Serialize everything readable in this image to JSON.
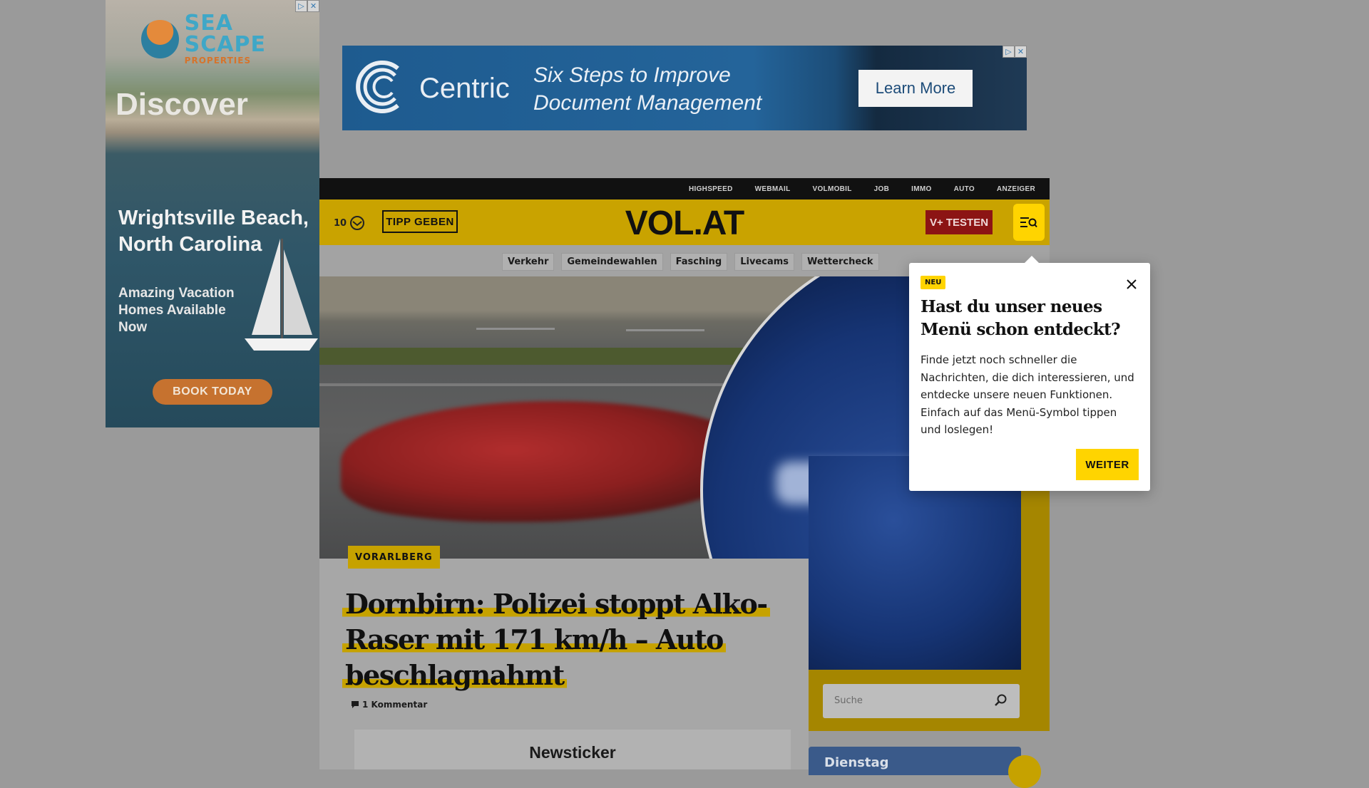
{
  "ads": {
    "skyscraper": {
      "brand": "SEA SCAPE",
      "brand_sub": "PROPERTIES",
      "discover": "Discover",
      "place": "Wrightsville Beach, North Carolina",
      "pitch": "Amazing Vacation Homes Available Now",
      "cta": "BOOK TODAY",
      "colors": {
        "cta": "#c6722f",
        "brand": "#3fa7c7"
      }
    },
    "banner": {
      "brand": "Centric",
      "headline_1": "Six Steps to Improve",
      "headline_2": "Document Management",
      "cta": "Learn More"
    },
    "adchoice_info": "▷",
    "adchoice_close": "✕"
  },
  "topbar": {
    "links": [
      "HIGHSPEED",
      "WEBMAIL",
      "VOLMOBIL",
      "JOB",
      "IMMO",
      "AUTO",
      "ANZEIGER"
    ]
  },
  "header": {
    "temperature": "10",
    "tipp_label": "TIPP GEBEN",
    "logo": "VOL.AT",
    "vplus_label": "V+ TESTEN",
    "menu_icon": "menu-search-icon",
    "colors": {
      "bar": "#c9a300",
      "vplus": "#8c1414",
      "menu": "#ffd400"
    }
  },
  "subnav": {
    "items": [
      "Verkehr",
      "Gemeindewahlen",
      "Fasching",
      "Livecams",
      "Wettercheck"
    ]
  },
  "article": {
    "category": "VORARLBERG",
    "headline": "Dornbirn: Polizei stoppt Alko-Raser mit 171 km/h – Auto beschlagnahmt",
    "comments": "1 Kommentar"
  },
  "search": {
    "placeholder": "Suche"
  },
  "newsticker": {
    "title": "Newsticker"
  },
  "rail": {
    "day": "Dienstag"
  },
  "popup": {
    "badge": "NEU",
    "title": "Hast du unser neues Menü schon entdeckt?",
    "text": "Finde jetzt noch schneller die Nachrichten, die dich interessieren, und entdecke unsere neuen Funktionen. Einfach auf das Menü-Symbol tippen und loslegen!",
    "button": "WEITER"
  }
}
